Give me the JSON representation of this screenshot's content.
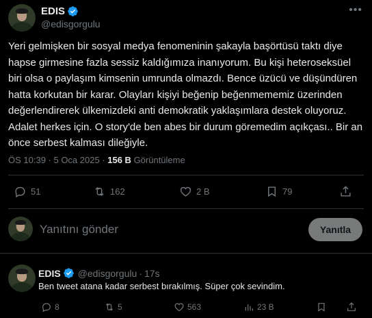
{
  "tweet": {
    "display_name": "EDIS",
    "handle": "@edisgorgulu",
    "more_icon": "more-horizontal-icon",
    "text": "Yeri gelmişken bir sosyal medya fenomeninin şakayla başörtüsü taktı diye hapse girmesine fazla sessiz kaldığımıza inanıyorum. Bu kişi heteroseksüel biri olsa o paylaşım kimsenin umrunda olmazdı. Bence üzücü ve düşündüren hatta korkutan bir karar. Olayları kişiyi beğenip beğenmememiz üzerinden değerlendirerek ülkemizdeki anti demokratik yaklaşımlara destek oluyoruz. Adalet herkes için. O story'de ben abes bir durum göremedim açıkçası.. Bir an önce serbest kalması dileğiyle.",
    "timestamp": "ÖS 10:39 · 5 Oca 2025 · ",
    "views_count": "156 B",
    "views_label": " Görüntüleme",
    "actions": {
      "reply_count": "51",
      "retweet_count": "162",
      "like_count": "2 B",
      "bookmark_count": "79"
    }
  },
  "reply_box": {
    "placeholder": "Yanıtını gönder",
    "button_label": "Yanıtla"
  },
  "reply_tweet": {
    "display_name": "EDIS",
    "handle": "@edisgorgulu",
    "separator": "·",
    "time": "17s",
    "text": "Ben tweet atana kadar serbest bırakılmış. Süper çok sevindim.",
    "actions": {
      "reply_count": "8",
      "retweet_count": "5",
      "like_count": "563",
      "views_count": "23 B"
    }
  },
  "colors": {
    "background": "#000000",
    "text": "#e7e9ea",
    "muted": "#71767b",
    "verified": "#1d9bf0",
    "button": "#787a7a"
  }
}
